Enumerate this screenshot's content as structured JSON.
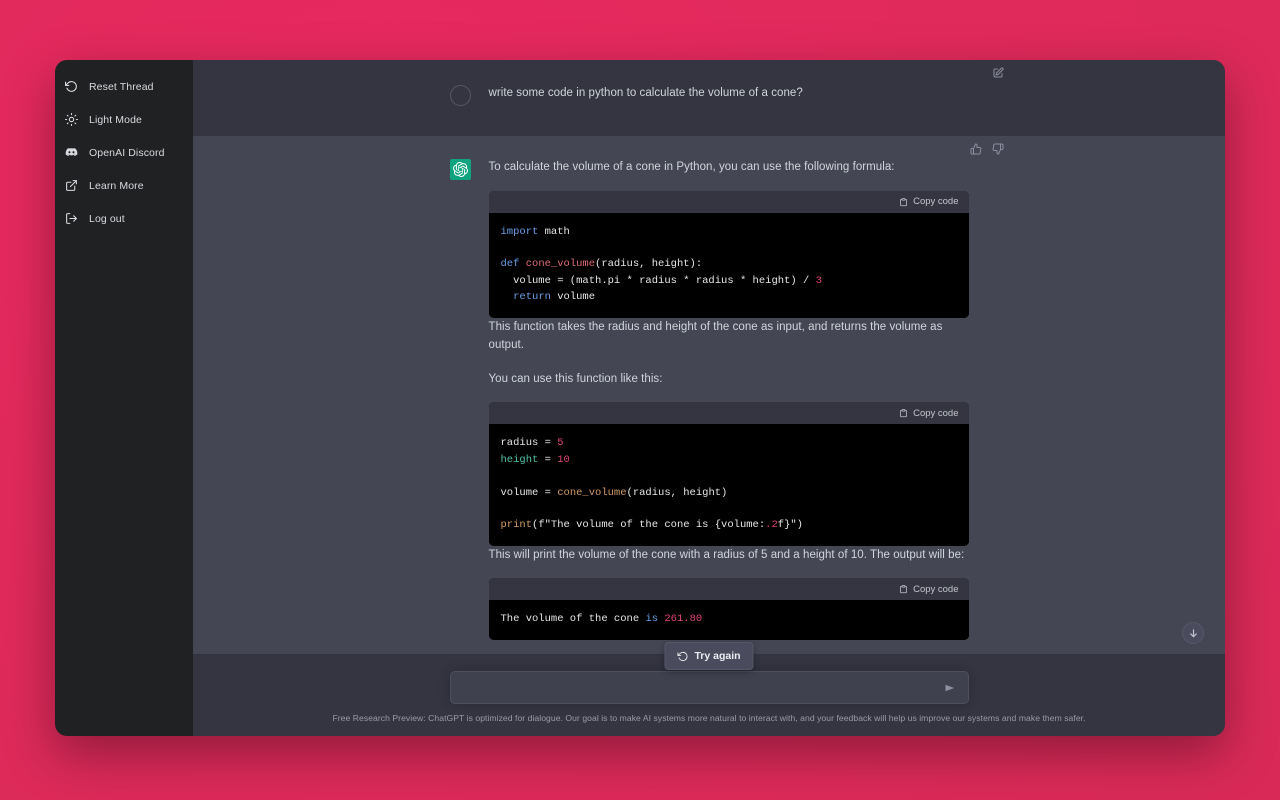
{
  "theme": {
    "desktop_bg": "#e12a5c",
    "sidebar_bg": "#202123",
    "user_msg_bg": "#343541",
    "bot_msg_bg": "#444654",
    "accent_green": "#10a37f",
    "code_bg": "#000000"
  },
  "sidebar": {
    "items": [
      {
        "label": "Reset Thread",
        "icon": "refresh-icon"
      },
      {
        "label": "Light Mode",
        "icon": "sun-icon"
      },
      {
        "label": "OpenAI Discord",
        "icon": "discord-icon"
      },
      {
        "label": "Learn More",
        "icon": "external-link-icon"
      },
      {
        "label": "Log out",
        "icon": "logout-icon"
      }
    ]
  },
  "conversation": {
    "user_message": {
      "text": "write some code in python to calculate the volume of a cone?",
      "edit_label": "Edit message"
    },
    "assistant_message": {
      "intro": "To calculate the volume of a cone in Python, you can use the following formula:",
      "para_after_code1_line1": "This function takes the radius and height of the cone as input, and returns the volume as",
      "para_after_code1_line2": "output.",
      "para_usage": "You can use this function like this:",
      "para_output_line1": "This will print the volume of the cone with a radius of 5 and a height of 10. The output will",
      "para_output_line2": "be:",
      "thumbs_up_label": "Good response",
      "thumbs_down_label": "Bad response"
    },
    "code_blocks": [
      {
        "copy_label": "Copy code",
        "language": "python",
        "lines": [
          [
            {
              "t": "import",
              "c": "k-kw"
            },
            {
              "t": " math",
              "c": ""
            }
          ],
          [
            {
              "t": "",
              "c": ""
            }
          ],
          [
            {
              "t": "def ",
              "c": "k-kw"
            },
            {
              "t": "cone_volume",
              "c": "k-fn-r"
            },
            {
              "t": "(radius, height):",
              "c": ""
            }
          ],
          [
            {
              "t": "  volume = (math.pi * radius * radius * height) / ",
              "c": ""
            },
            {
              "t": "3",
              "c": "k-num"
            }
          ],
          [
            {
              "t": "  ",
              "c": ""
            },
            {
              "t": "return",
              "c": "k-kw"
            },
            {
              "t": " volume",
              "c": ""
            }
          ]
        ]
      },
      {
        "copy_label": "Copy code",
        "language": "python",
        "lines": [
          [
            {
              "t": "radius = ",
              "c": ""
            },
            {
              "t": "5",
              "c": "k-num"
            }
          ],
          [
            {
              "t": "height",
              "c": "k-grn"
            },
            {
              "t": " = ",
              "c": ""
            },
            {
              "t": "10",
              "c": "k-num"
            }
          ],
          [
            {
              "t": "",
              "c": ""
            }
          ],
          [
            {
              "t": "volume = ",
              "c": ""
            },
            {
              "t": "cone_volume",
              "c": "k-fn-o"
            },
            {
              "t": "(radius, height)",
              "c": ""
            }
          ],
          [
            {
              "t": "",
              "c": ""
            }
          ],
          [
            {
              "t": "print",
              "c": "k-fn-o"
            },
            {
              "t": "(f\"The volume of the cone is {volume:",
              "c": ""
            },
            {
              "t": ".2",
              "c": "k-num"
            },
            {
              "t": "f}\")",
              "c": ""
            }
          ]
        ]
      },
      {
        "copy_label": "Copy code",
        "language": "text",
        "lines": [
          [
            {
              "t": "The volume of the cone ",
              "c": ""
            },
            {
              "t": "is",
              "c": "k-blu"
            },
            {
              "t": " ",
              "c": ""
            },
            {
              "t": "261.80",
              "c": "k-num"
            }
          ]
        ]
      }
    ]
  },
  "try_again": {
    "label": "Try again",
    "icon": "refresh-icon"
  },
  "scroll_to_bottom": {
    "label": "Scroll to bottom",
    "icon": "arrow-down-icon"
  },
  "composer": {
    "value": "",
    "placeholder": "",
    "send_label": "Send message",
    "send_icon": "send-arrow-icon"
  },
  "footer": {
    "text": "Free Research Preview: ChatGPT is optimized for dialogue. Our goal is to make AI systems more natural to interact with, and your feedback will help us improve our systems and make them safer."
  }
}
